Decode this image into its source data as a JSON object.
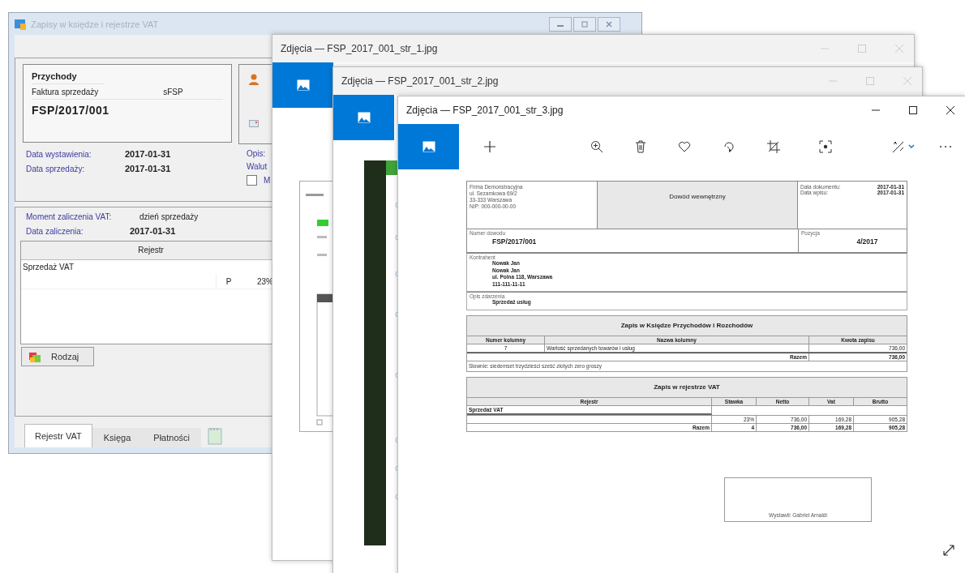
{
  "main_window": {
    "title": "Zapisy w księdze i rejestrze VAT",
    "active": false,
    "document": {
      "category": "Przychody",
      "type": "Faktura sprzedaży",
      "series": "sFSP",
      "number": "FSP/2017/001"
    },
    "dates": [
      {
        "label": "Data wystawienia:",
        "value": "2017-01-31"
      },
      {
        "label": "Data sprzedaży:",
        "value": "2017-01-31"
      }
    ],
    "side_labels": [
      "Opis:",
      "Walut"
    ],
    "checkbox": {
      "label": "M",
      "checked": false
    },
    "vat_moment": {
      "label": "Moment zaliczenia VAT:",
      "value": "dzień sprzedaży"
    },
    "vat_date": {
      "label": "Data zaliczenia:",
      "value": "2017-01-31"
    },
    "register_table": {
      "header": "Rejestr",
      "group": "Sprzedaż VAT",
      "cells": [
        "P",
        "23%"
      ]
    },
    "button": "Rodzaj",
    "tabs": [
      {
        "label": "Rejestr VAT",
        "selected": true
      },
      {
        "label": "Księga",
        "selected": false
      },
      {
        "label": "Płatności",
        "selected": false
      }
    ]
  },
  "photo_windows": [
    {
      "title": "Zdjęcia — FSP_2017_001_str_1.jpg",
      "active": false
    },
    {
      "title": "Zdjęcia — FSP_2017_001_str_2.jpg",
      "active": false
    },
    {
      "title": "Zdjęcia — FSP_2017_001_str_3.jpg",
      "active": true
    }
  ],
  "viewer_document": {
    "company": [
      "Firma Demonstracyjna",
      "ul. Sezamkowa 69/2",
      "33-333 Warszawa",
      "NIP: 000-000-00-00"
    ],
    "title": "Dowód wewnętrzny",
    "dates": [
      {
        "label": "Data dokumentu:",
        "value": "2017-01-31"
      },
      {
        "label": "Data wpisu:",
        "value": "2017-01-31"
      }
    ],
    "number": {
      "label": "Numer dowodu",
      "value": "FSP/2017/001"
    },
    "position": {
      "label": "Pozycja",
      "value": "4/2017"
    },
    "contractor": {
      "label": "Kontrahent",
      "lines": [
        "Nowak Jan",
        "Nowak Jan",
        "ul. Polna 118, Warszawa",
        "111-111-11-11"
      ]
    },
    "description": {
      "label": "Opis zdarzenia",
      "value": "Sprzedaż usług"
    },
    "ledger": {
      "title": "Zapis w Księdze Przychodów i Rozchodów",
      "columns": [
        "Numer kolumny",
        "Nazwa kolumny",
        "Kwota zapisu"
      ],
      "row": [
        "7",
        "Wartość sprzedanych towarów i usług",
        "736,00"
      ],
      "total": [
        "Razem",
        "736,00"
      ],
      "in_words": "Słownie: siedemset trzydzieści sześć złotych zero groszy"
    },
    "vat": {
      "title": "Zapis w rejestrze VAT",
      "columns": [
        "Rejestr",
        "Stawka",
        "Netto",
        "Vat",
        "Brutto"
      ],
      "group": "Sprzedaż VAT",
      "row": [
        "23%",
        "736,00",
        "169,28",
        "905,28"
      ],
      "total": [
        "Razem",
        "4",
        "736,00",
        "169,28",
        "905,28"
      ]
    },
    "signature": "Wystawił: Gabriel Arnaldi"
  }
}
